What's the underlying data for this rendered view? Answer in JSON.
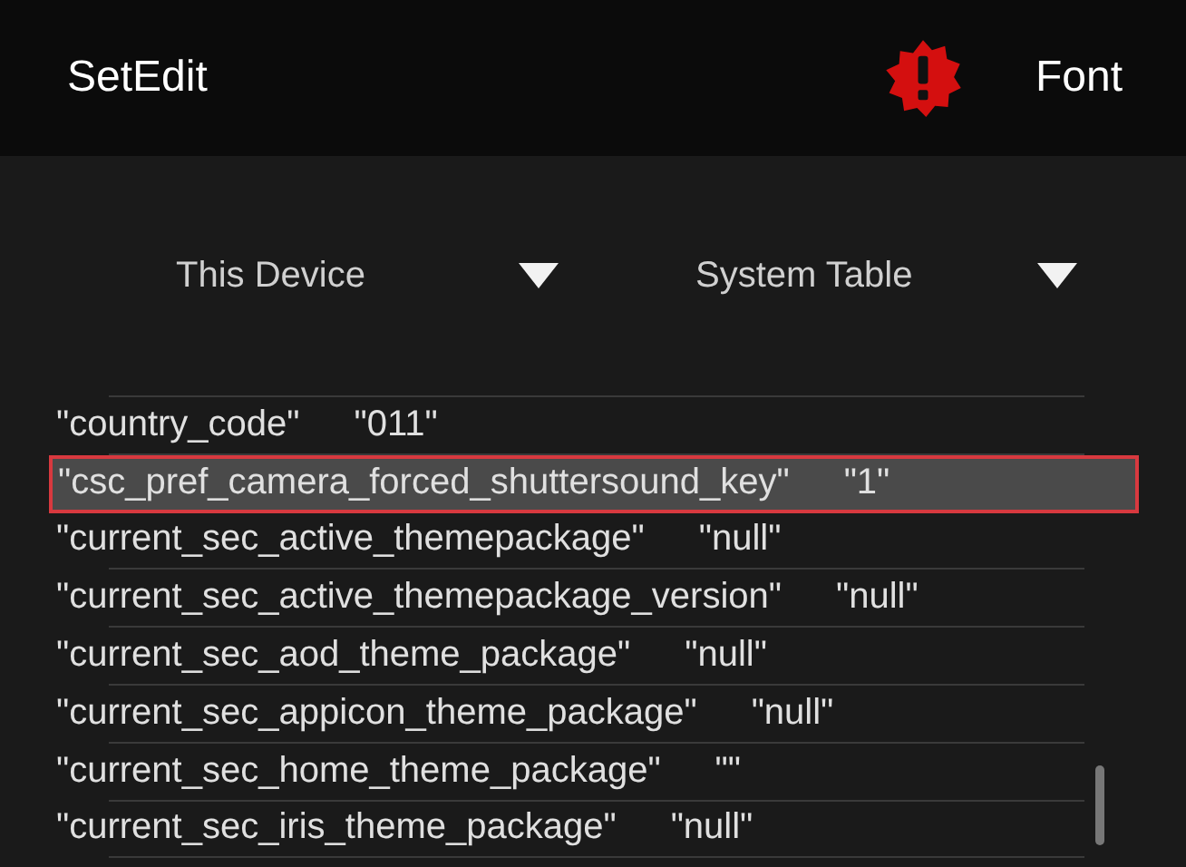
{
  "app_bar": {
    "title": "SetEdit",
    "action": "Font"
  },
  "dropdowns": [
    {
      "label": "This Device"
    },
    {
      "label": "System Table"
    }
  ],
  "settings": [
    {
      "key": "\"country_code\"",
      "value": "\"011\"",
      "selected": false
    },
    {
      "key": "\"csc_pref_camera_forced_shuttersound_key\"",
      "value": "\"1\"",
      "selected": true
    },
    {
      "key": "\"current_sec_active_themepackage\"",
      "value": "\"null\"",
      "selected": false
    },
    {
      "key": "\"current_sec_active_themepackage_version\"",
      "value": "\"null\"",
      "selected": false
    },
    {
      "key": "\"current_sec_aod_theme_package\"",
      "value": "\"null\"",
      "selected": false
    },
    {
      "key": "\"current_sec_appicon_theme_package\"",
      "value": "\"null\"",
      "selected": false
    },
    {
      "key": "\"current_sec_home_theme_package\"",
      "value": "\"\"",
      "selected": false
    },
    {
      "key": "\"current_sec_iris_theme_package\"",
      "value": "\"null\"",
      "selected": false
    }
  ]
}
